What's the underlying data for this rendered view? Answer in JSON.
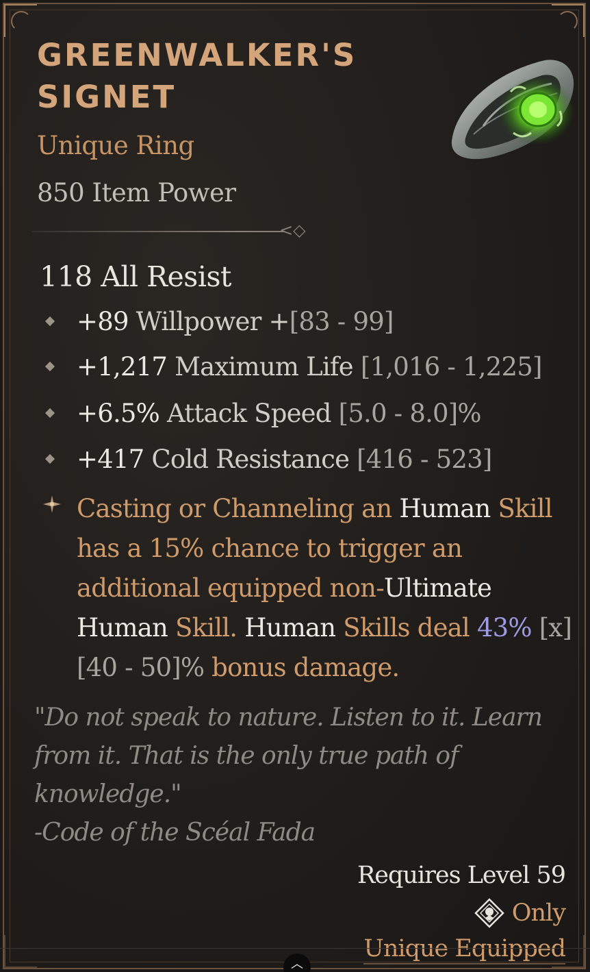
{
  "item": {
    "name_line1": "GREENWALKER'S",
    "name_line2": "SIGNET",
    "type": "Unique Ring",
    "item_power": "850 Item Power",
    "icon": "green-gem-ring-icon"
  },
  "base_stat": "118 All Resist",
  "affixes": [
    {
      "value": "+89",
      "stat": " Willpower +",
      "range": "[83 - 99]"
    },
    {
      "value": "+1,217",
      "stat": " Maximum Life ",
      "range": "[1,016 - 1,225]"
    },
    {
      "value": "+6.5%",
      "stat": " Attack Speed ",
      "range": "[5.0 - 8.0]%"
    },
    {
      "value": "+417",
      "stat": " Cold Resistance ",
      "range": "[416 - 523]"
    }
  ],
  "unique_power": {
    "p1": "Casting or Channeling an ",
    "p2": "Human",
    "p3": " Skill has a 15% chance to trigger an additional equipped non-",
    "p4": "Ultimate",
    "p5": " Human",
    "p6": " Skill. ",
    "p7": "Human",
    "p8": " Skills deal ",
    "p9": "43%",
    "p10": " [x] [40 - 50]%",
    "p11": " bonus damage."
  },
  "flavor": {
    "quote": "\"Do not speak to nature. Listen to it. Learn from it. That is the only true path of knowledge.\"",
    "source": "-Code of the Scéal Fada"
  },
  "requirements": {
    "level": "Requires Level 59",
    "only": "Only",
    "unique_equipped": "Unique Equipped"
  },
  "colors": {
    "title": "#d4a57a",
    "unique": "#d09b6a",
    "highlight_blue": "#9e9ae6",
    "range_grey": "#a9a49d"
  }
}
